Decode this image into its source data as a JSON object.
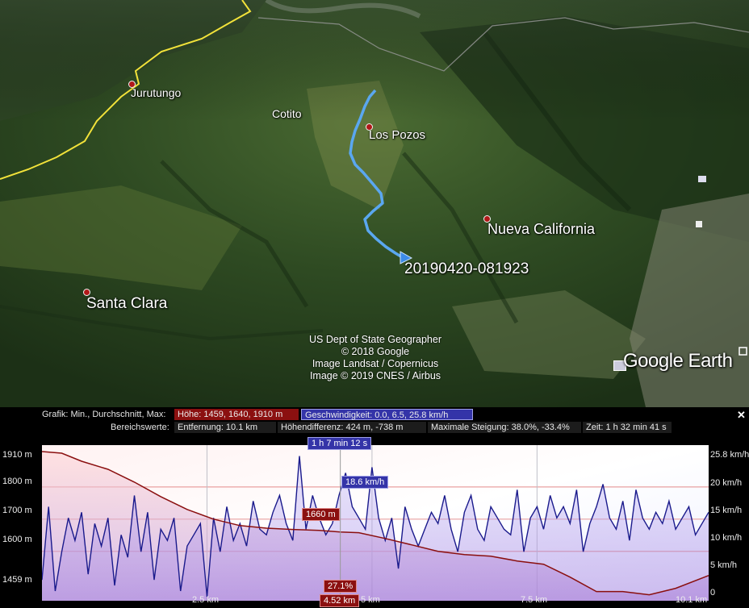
{
  "map": {
    "places": [
      {
        "name": "Jurutungo",
        "dot": true
      },
      {
        "name": "Cotito",
        "dot": false
      },
      {
        "name": "Los Pozos",
        "dot": true
      },
      {
        "name": "Nueva California",
        "dot": true
      },
      {
        "name": "Santa Clara",
        "dot": true
      }
    ],
    "track_label": "20190420-081923",
    "attribution": [
      "US Dept of State Geographer",
      "© 2018 Google",
      "Image Landsat / Copernicus",
      "Image © 2019 CNES / Airbus"
    ],
    "logo": "Google Earth",
    "colors": {
      "track": "#5aa7f0",
      "border": "#f2e23a",
      "place_dot": "#b01818"
    }
  },
  "profile": {
    "grafik_label": "Grafik: Min., Durchschnitt, Max:",
    "hoehe": "Höhe: 1459, 1640, 1910 m",
    "geschwindigkeit": "Geschwindigkeit: 0.0, 6.5, 25.8 km/h",
    "bereich_label": "Bereichswerte:",
    "entfernung": "Entfernung: 10.1 km",
    "hoehendifferenz": "Höhendifferenz: 424 m, -738 m",
    "steigung": "Maximale Steigung: 38.0%, -33.4%",
    "zeit": "Zeit: 1 h 32 min 41 s",
    "close": "✕",
    "cursor": {
      "time": "1 h 7 min 12 s",
      "speed": "18.6 km/h",
      "elevation": "1660 m",
      "grade": "27.1%",
      "distance": "4.52 km",
      "distance_value": 4.52
    },
    "colors": {
      "elevation": "#8a0f0f",
      "speed": "#1a1a8c",
      "elev_box": "#8b1010",
      "speed_box": "#3434a8"
    }
  },
  "chart_data": {
    "type": "line",
    "xlim": [
      0,
      10.1
    ],
    "x_ticks": [
      "2.5 km",
      "5 km",
      "7.5 km",
      "10.1 km"
    ],
    "y_left_ticks": [
      "1910 m",
      "1800 m",
      "1700 m",
      "1600 m",
      "1459 m"
    ],
    "y_left_lim": [
      1459,
      1910
    ],
    "y_right_ticks": [
      "25.8 km/h",
      "20 km/h",
      "15 km/h",
      "10 km/h",
      "5 km/h",
      "0"
    ],
    "y_right_lim": [
      0,
      25.8
    ],
    "series": [
      {
        "name": "Höhe",
        "axis": "left",
        "x": [
          0,
          0.3,
          0.6,
          1.0,
          1.4,
          1.8,
          2.2,
          2.6,
          3.0,
          3.4,
          3.8,
          4.2,
          4.52,
          4.8,
          5.2,
          5.6,
          6.0,
          6.4,
          6.8,
          7.2,
          7.6,
          8.0,
          8.4,
          8.8,
          9.2,
          9.6,
          10.1
        ],
        "y": [
          1910,
          1905,
          1880,
          1855,
          1815,
          1770,
          1730,
          1700,
          1680,
          1672,
          1668,
          1665,
          1660,
          1658,
          1640,
          1620,
          1600,
          1590,
          1585,
          1570,
          1560,
          1520,
          1475,
          1475,
          1465,
          1485,
          1525
        ]
      },
      {
        "name": "Geschwindigkeit",
        "axis": "right",
        "x": [
          0,
          0.1,
          0.2,
          0.3,
          0.4,
          0.5,
          0.6,
          0.7,
          0.8,
          0.9,
          1.0,
          1.1,
          1.2,
          1.3,
          1.4,
          1.5,
          1.6,
          1.7,
          1.8,
          1.9,
          2.0,
          2.1,
          2.2,
          2.3,
          2.4,
          2.5,
          2.6,
          2.7,
          2.8,
          2.9,
          3.0,
          3.1,
          3.2,
          3.3,
          3.4,
          3.5,
          3.6,
          3.7,
          3.8,
          3.9,
          4.0,
          4.1,
          4.2,
          4.3,
          4.4,
          4.5,
          4.6,
          4.7,
          4.8,
          4.9,
          5.0,
          5.1,
          5.2,
          5.3,
          5.4,
          5.5,
          5.6,
          5.7,
          5.8,
          5.9,
          6.0,
          6.1,
          6.2,
          6.3,
          6.4,
          6.5,
          6.6,
          6.7,
          6.8,
          6.9,
          7.0,
          7.1,
          7.2,
          7.3,
          7.4,
          7.5,
          7.6,
          7.7,
          7.8,
          7.9,
          8.0,
          8.1,
          8.2,
          8.3,
          8.4,
          8.5,
          8.6,
          8.7,
          8.8,
          8.9,
          9.0,
          9.1,
          9.2,
          9.3,
          9.4,
          9.5,
          9.6,
          9.7,
          9.8,
          9.9,
          10.0,
          10.1
        ],
        "y": [
          3,
          16,
          1,
          8,
          14,
          10,
          15,
          4,
          13,
          9,
          14,
          2,
          11,
          7,
          18,
          8,
          15,
          3,
          12,
          10,
          14,
          1,
          9,
          11,
          13,
          0,
          14,
          8,
          16,
          10,
          13,
          9,
          17,
          12,
          11,
          15,
          18,
          13,
          10,
          25,
          12,
          18,
          14,
          11,
          13,
          18,
          22,
          16,
          14,
          12,
          23,
          14,
          10,
          14,
          5,
          16,
          12,
          9,
          12,
          15,
          13,
          18,
          12,
          8,
          15,
          18,
          12,
          10,
          16,
          14,
          12,
          11,
          19,
          8,
          14,
          16,
          12,
          18,
          14,
          16,
          13,
          19,
          8,
          13,
          16,
          20,
          14,
          12,
          17,
          10,
          19,
          14,
          12,
          15,
          13,
          17,
          12,
          14,
          16,
          11,
          13,
          15
        ]
      }
    ]
  }
}
